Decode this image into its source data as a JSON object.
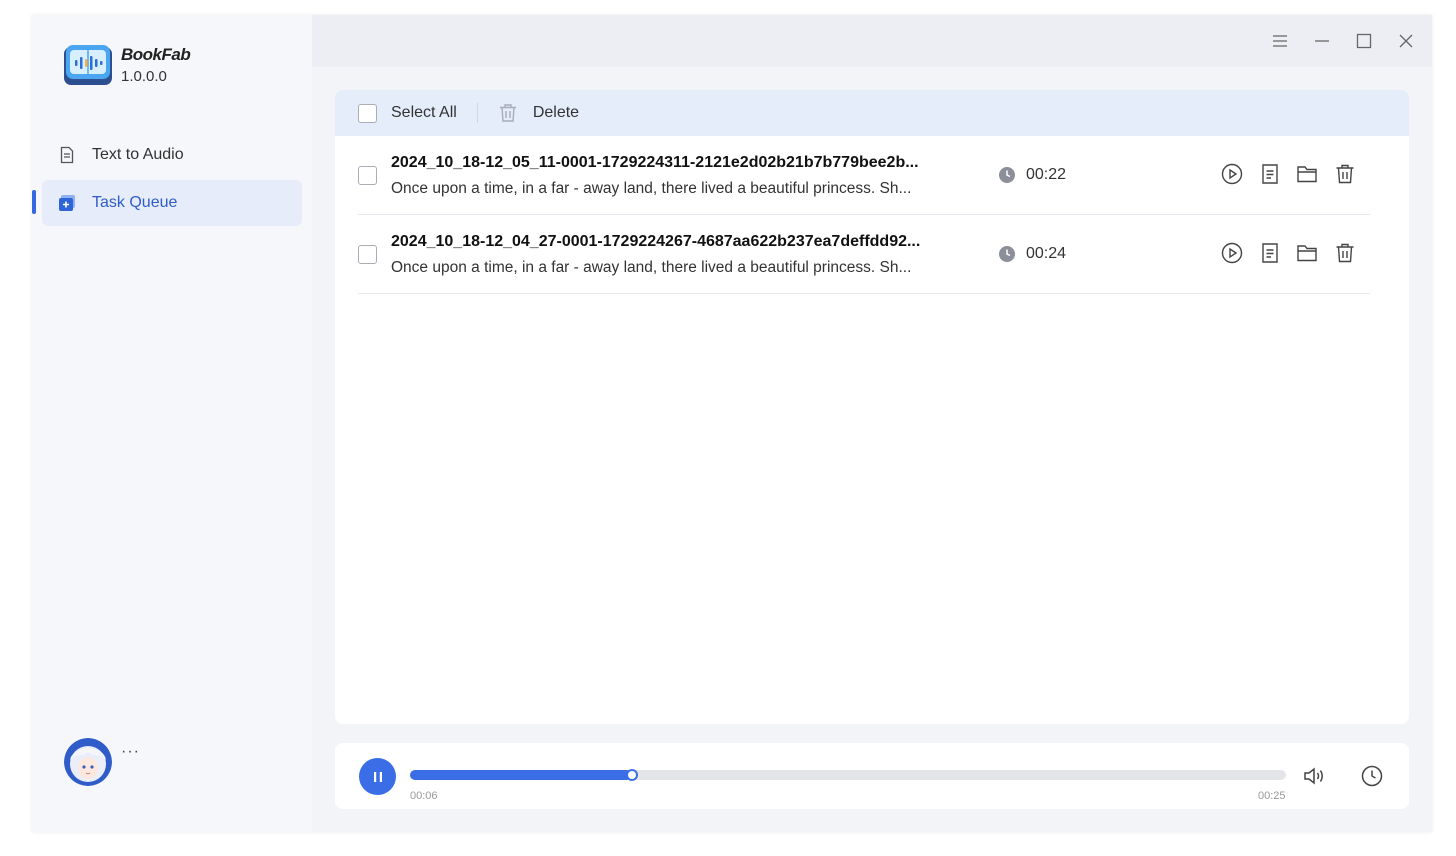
{
  "app": {
    "name": "BookFab",
    "version": "1.0.0.0"
  },
  "sidebar": {
    "items": [
      {
        "label": "Text to Audio",
        "icon": "document-icon",
        "active": false
      },
      {
        "label": "Task Queue",
        "icon": "queue-icon",
        "active": true
      }
    ],
    "avatar_more": "···"
  },
  "toolbar": {
    "select_all_label": "Select All",
    "delete_label": "Delete"
  },
  "tasks": [
    {
      "title": "2024_10_18-12_05_11-0001-1729224311-2121e2d02b21b7b779bee2b...",
      "description": "Once upon a time, in a far - away land, there lived a beautiful princess. Sh...",
      "duration": "00:22"
    },
    {
      "title": "2024_10_18-12_04_27-0001-1729224267-4687aa622b237ea7deffdd92...",
      "description": "Once upon a time, in a far - away land, there lived a beautiful princess. Sh...",
      "duration": "00:24"
    }
  ],
  "player": {
    "current_time": "00:06",
    "total_time": "00:25",
    "progress_fraction": 0.253
  },
  "colors": {
    "accent": "#3b6ee6",
    "active_bg": "#e6ecf9",
    "toolbar_bg": "#e5ecfa"
  }
}
